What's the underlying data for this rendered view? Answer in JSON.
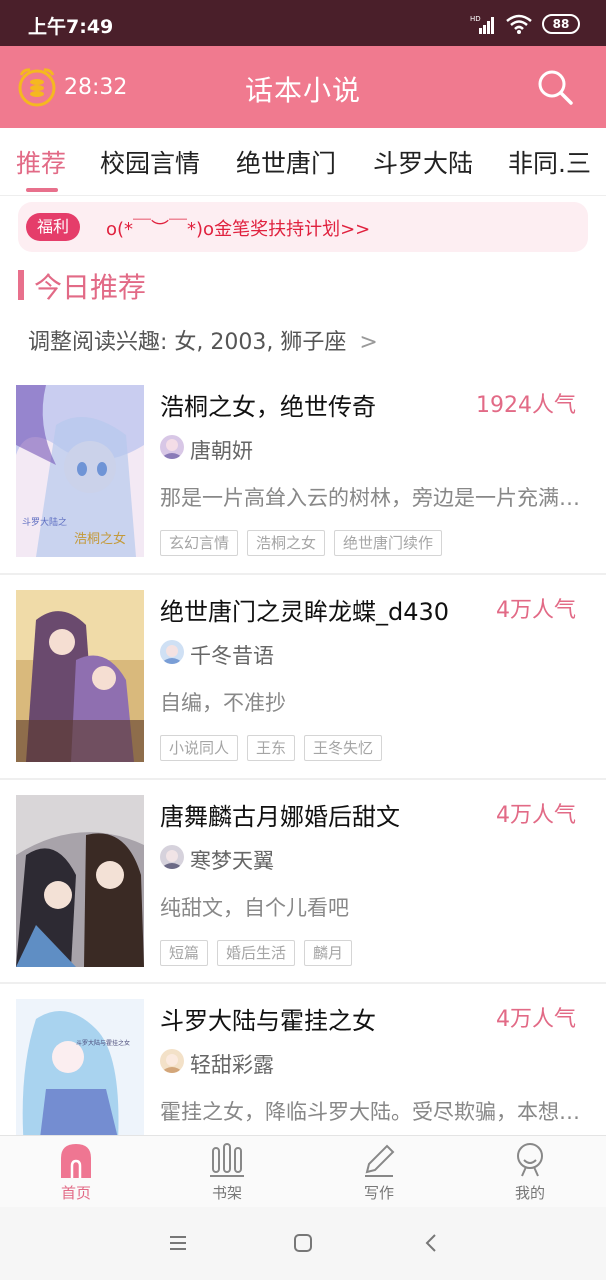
{
  "status_bar": {
    "time": "上午7:49",
    "battery": "88"
  },
  "header": {
    "timer": "28:32",
    "title": "话本小说"
  },
  "tabs": [
    {
      "label": "推荐",
      "active": true
    },
    {
      "label": "校园言情"
    },
    {
      "label": "绝世唐门"
    },
    {
      "label": "斗罗大陆"
    },
    {
      "label": "非同.三"
    }
  ],
  "notice": {
    "badge": "福利",
    "text": "o(*￣︶￣*)o金笔奖扶持计划>>"
  },
  "section": {
    "title": "今日推荐",
    "interest": "调整阅读兴趣: 女, 2003, 狮子座",
    "interest_arrow": ">"
  },
  "books": [
    {
      "title": "浩桐之女，绝世传奇",
      "popularity": "1924人气",
      "author": "唐朝妍",
      "description": "那是一片高耸入云的树林，旁边是一片充满灵气的湖",
      "tags": [
        "玄幻言情",
        "浩桐之女",
        "绝世唐门续作"
      ],
      "cover_text": [
        "斗罗大陆之",
        "浩桐之女"
      ],
      "colors": {
        "cover_a": "#c9cdf0",
        "cover_b": "#f3e9f4"
      }
    },
    {
      "title": "绝世唐门之灵眸龙蝶_d430",
      "popularity": "4万人气",
      "author": "千冬昔语",
      "description": "自编，不准抄",
      "tags": [
        "小说同人",
        "王东",
        "王冬失忆"
      ],
      "cover_text": [],
      "colors": {
        "cover_a": "#6a4a6e",
        "cover_b": "#d9b97c"
      }
    },
    {
      "title": "唐舞麟古月娜婚后甜文",
      "popularity": "4万人气",
      "author": "寒梦天翼",
      "description": "纯甜文，自个儿看吧",
      "tags": [
        "短篇",
        "婚后生活",
        "麟月"
      ],
      "cover_text": [],
      "colors": {
        "cover_a": "#2d2a33",
        "cover_b": "#a8a3aa"
      }
    },
    {
      "title": "斗罗大陆与霍挂之女",
      "popularity": "4万人气",
      "author": "轻甜彩露",
      "description": "霍挂之女，降临斗罗大陆。受尽欺骗，本想报仇。",
      "tags": [],
      "cover_text": [
        "斗罗大陆与霍挂之女"
      ],
      "colors": {
        "cover_a": "#a9d3ef",
        "cover_b": "#eef4fb"
      }
    }
  ],
  "bottom_nav": [
    {
      "label": "首页",
      "icon": "home-icon",
      "active": true
    },
    {
      "label": "书架",
      "icon": "bookshelf-icon"
    },
    {
      "label": "写作",
      "icon": "pencil-icon"
    },
    {
      "label": "我的",
      "icon": "profile-icon"
    }
  ],
  "colors": {
    "accent": "#f07a8f",
    "accent_text": "#e26a86",
    "status_bar": "#4a1f2a",
    "notice_text": "#e0213e"
  }
}
